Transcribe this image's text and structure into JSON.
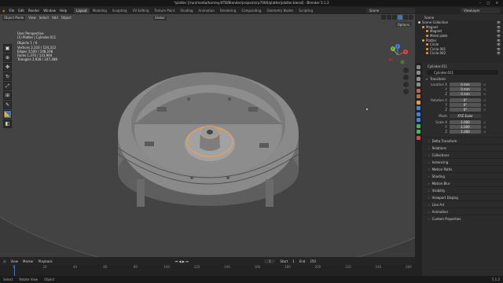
{
  "window": {
    "title": "*platter [/run/media/tommy/4TB/Blender/projects/rp7000/platter/platter.blend] - Blender 5.1.2",
    "controls": "– ▢ ✕"
  },
  "menubar": {
    "items": [
      "File",
      "Edit",
      "Render",
      "Window",
      "Help"
    ],
    "workspaces": [
      "Layout",
      "Modeling",
      "Sculpting",
      "UV Editing",
      "Texture Paint",
      "Shading",
      "Animation",
      "Rendering",
      "Compositing",
      "Geometry Nodes",
      "Scripting"
    ],
    "active_workspace": "Layout",
    "scene": "Scene",
    "view_layer": "ViewLayer"
  },
  "viewport": {
    "mode": "Object Mode",
    "menus": [
      "View",
      "Select",
      "Add",
      "Object"
    ],
    "orientation": "Global",
    "options_label": "Options",
    "info": {
      "view": "User Perspective",
      "collection": "(1) Platter | Cylinder.011",
      "objects_label": "Objects",
      "objects": "1 / 6",
      "vertices_label": "Vertices",
      "vertices": "2,210 / 124,312",
      "edges_label": "Edges",
      "edges": "3,540 / 248,168",
      "faces_label": "Faces",
      "faces": "1,370 / 123,964",
      "triangles_label": "Triangles",
      "triangles": "2,928 / 247,488"
    },
    "gizmo": {
      "x": "X",
      "y": "Y",
      "z": "Z"
    },
    "tools": [
      "cursor",
      "move",
      "rotate",
      "scale",
      "transform",
      "annotate",
      "measure",
      "add-cube"
    ]
  },
  "timeline": {
    "menus": [
      "View",
      "Marker",
      "Playback"
    ],
    "current_frame": "1",
    "start_label": "Start",
    "start": "1",
    "end_label": "End",
    "end": "250",
    "ticks": [
      "1",
      "20",
      "40",
      "60",
      "80",
      "100",
      "120",
      "140",
      "160",
      "180",
      "200",
      "220",
      "240",
      "260"
    ]
  },
  "status": {
    "items": [
      "Select",
      "Rotate View",
      "Object"
    ],
    "version": "5.1.2"
  },
  "outliner": {
    "header": "Scene",
    "rows": [
      {
        "label": "Scene Collection",
        "indent": 0,
        "color": "#c8c8c8"
      },
      {
        "label": "Magnet",
        "indent": 1,
        "color": "#e5a23c"
      },
      {
        "label": "Magnet",
        "indent": 2,
        "color": "#e5a23c"
      },
      {
        "label": "Metal plate",
        "indent": 2,
        "color": "#e5a23c"
      },
      {
        "label": "Platter",
        "indent": 1,
        "color": "#e5a23c"
      },
      {
        "label": "Circle",
        "indent": 2,
        "color": "#e5a23c"
      },
      {
        "label": "Circle.001",
        "indent": 2,
        "color": "#e5a23c"
      },
      {
        "label": "Circle.002",
        "indent": 2,
        "color": "#e5a23c"
      }
    ]
  },
  "properties": {
    "object_name": "Cylinder.011",
    "data_name": "Cylinder.011",
    "transform_label": "Transform",
    "location_label": "Location X",
    "location": [
      "0 mm",
      "0 mm",
      "0 mm"
    ],
    "rotation_label": "Rotation X",
    "rotation": [
      "0°",
      "0°",
      "0°"
    ],
    "mode_label": "Mode",
    "mode": "XYZ Euler",
    "scale_label": "Scale X",
    "scale": [
      "1.000",
      "1.000",
      "1.000"
    ],
    "axis_y": "Y",
    "axis_z": "Z",
    "sections": [
      "Delta Transform",
      "Relations",
      "Collections",
      "Instancing",
      "Motion Paths",
      "Shading",
      "Motion Blur",
      "Visibility",
      "Viewport Display",
      "Line Art",
      "Animation",
      "Custom Properties"
    ]
  },
  "colors": {
    "accent": "#4772b3",
    "selection": "#f0a04b",
    "viewport_bg": "#3a3a3a"
  }
}
